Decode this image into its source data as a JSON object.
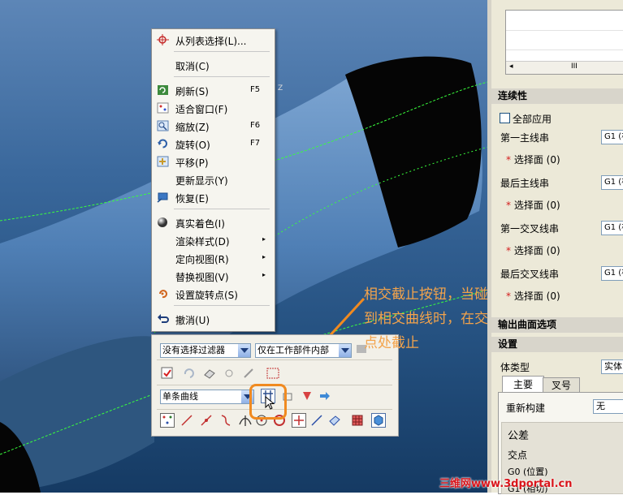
{
  "context_menu": {
    "items": [
      {
        "label": "从列表选择(L)...",
        "shortcut": "",
        "submenu": false,
        "icon": "crosshair-icon"
      },
      {
        "label": "取消(C)",
        "shortcut": "",
        "submenu": false,
        "icon": ""
      },
      {
        "label": "刷新(S)",
        "shortcut": "F5",
        "submenu": false,
        "icon": "refresh-icon"
      },
      {
        "label": "适合窗口(F)",
        "shortcut": "",
        "submenu": false,
        "icon": "fit-window-icon"
      },
      {
        "label": "缩放(Z)",
        "shortcut": "F6",
        "submenu": false,
        "icon": "zoom-icon"
      },
      {
        "label": "旋转(O)",
        "shortcut": "F7",
        "submenu": false,
        "icon": "rotate-icon"
      },
      {
        "label": "平移(P)",
        "shortcut": "",
        "submenu": false,
        "icon": "pan-icon"
      },
      {
        "label": "更新显示(Y)",
        "shortcut": "",
        "submenu": false,
        "icon": ""
      },
      {
        "label": "恢复(E)",
        "shortcut": "",
        "submenu": false,
        "icon": "restore-icon"
      },
      {
        "label": "真实着色(I)",
        "shortcut": "",
        "submenu": false,
        "icon": "true-shading-icon"
      },
      {
        "label": "渲染样式(D)",
        "shortcut": "",
        "submenu": true,
        "icon": ""
      },
      {
        "label": "定向视图(R)",
        "shortcut": "",
        "submenu": true,
        "icon": ""
      },
      {
        "label": "替换视图(V)",
        "shortcut": "",
        "submenu": true,
        "icon": ""
      },
      {
        "label": "设置旋转点(S)",
        "shortcut": "",
        "submenu": false,
        "icon": "rotation-point-icon"
      },
      {
        "label": "撤消(U)",
        "shortcut": "",
        "submenu": false,
        "icon": "undo-icon"
      }
    ],
    "submenu_arrow": "▸"
  },
  "selection_bar": {
    "filter_value": "没有选择过滤器",
    "scope_value": "仅在工作部件内部",
    "curve_rule_value": "单条曲线"
  },
  "annotation": {
    "lines": [
      "相交截止按钮，当碰",
      "到相交曲线时，在交",
      "点处截止"
    ],
    "color": "#f3a34b"
  },
  "viewport": {
    "axis_label": "Z"
  },
  "panel": {
    "scroll_glyph": "III",
    "continuity_header": "连续性",
    "apply_all": "全部应用",
    "rows": [
      {
        "label": "第一主线串",
        "value": "G1 (相",
        "sub": "选择面 (0)"
      },
      {
        "label": "最后主线串",
        "value": "G1 (相",
        "sub": "选择面 (0)"
      },
      {
        "label": "第一交叉线串",
        "value": "G1 (相",
        "sub": "选择面 (0)"
      },
      {
        "label": "最后交叉线串",
        "value": "G1 (相",
        "sub": "选择面 (0)"
      }
    ],
    "star": "*",
    "output_header": "输出曲面选项",
    "settings_header": "设置",
    "body_type_label": "体类型",
    "body_type_value": "实体",
    "tabs": [
      "主要",
      "叉号"
    ],
    "rebuild_label": "重新构建",
    "rebuild_value": "无",
    "tolerance_header": "公差",
    "intersection_label": "交点",
    "g0_label": "G0 (位置)",
    "g1_label": "G1 (相切)"
  },
  "watermark": "三维网www.3dportal.cn"
}
